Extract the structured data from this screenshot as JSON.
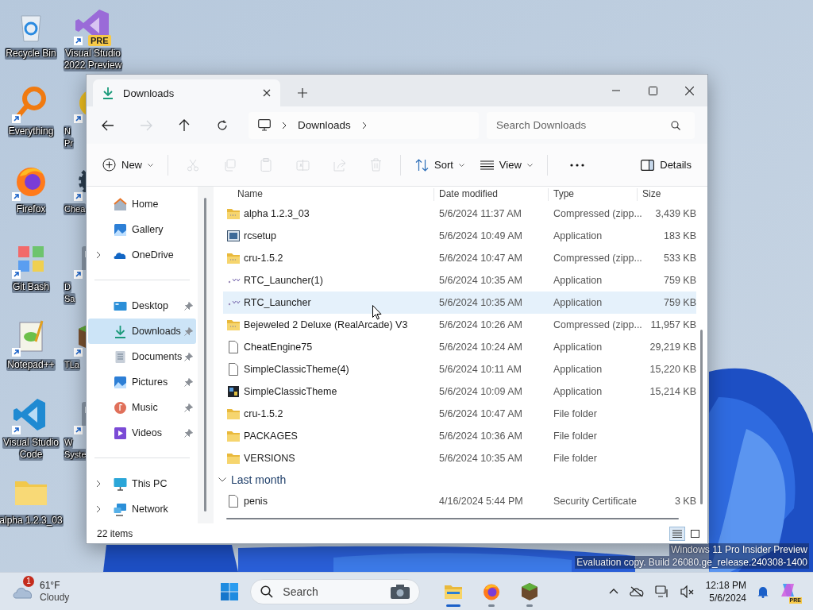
{
  "desktop": {
    "columns": [
      [
        {
          "lines": [
            "Recycle Bin"
          ],
          "kind": "recycle",
          "shortcut": false
        },
        {
          "lines": [
            "Everything"
          ],
          "kind": "magnifier",
          "shortcut": true
        },
        {
          "lines": [
            "Firefox"
          ],
          "kind": "firefox",
          "shortcut": true
        },
        {
          "lines": [
            "Git Bash"
          ],
          "kind": "git",
          "shortcut": true
        },
        {
          "lines": [
            "Notepad++"
          ],
          "kind": "notepad",
          "shortcut": true
        },
        {
          "lines": [
            "Visual Studio",
            "Code"
          ],
          "kind": "vscode",
          "shortcut": true
        },
        {
          "lines": [
            "alpha 1.2.3_03"
          ],
          "kind": "folder",
          "shortcut": false
        }
      ],
      [
        {
          "lines": [
            "Visual Studio",
            "2022 Preview"
          ],
          "kind": "vs",
          "badge": "PRE",
          "shortcut": true
        },
        {
          "lines": [
            "N",
            "Pr"
          ],
          "kind": "flame",
          "shortcut": true
        },
        {
          "lines": [
            "Chea"
          ],
          "kind": "gear",
          "shortcut": true
        },
        {
          "lines": [
            "D",
            "Sa"
          ],
          "kind": "generic",
          "shortcut": true
        },
        {
          "lines": [
            "TLa"
          ],
          "kind": "cube",
          "shortcut": true
        },
        {
          "lines": [
            "W",
            "Syste"
          ],
          "kind": "generic",
          "shortcut": true
        }
      ]
    ]
  },
  "window": {
    "tabs": [
      {
        "label": "Downloads",
        "selected": true
      }
    ],
    "nav": [
      {
        "kind": "back",
        "disabled": false
      },
      {
        "kind": "forward",
        "disabled": true
      },
      {
        "kind": "up",
        "disabled": false
      },
      {
        "kind": "refresh",
        "disabled": false
      }
    ],
    "breadcrumb": [
      "Downloads"
    ],
    "search": {
      "placeholder": "Search Downloads"
    },
    "toolbar": [
      {
        "kind": "new",
        "label": "New",
        "disabled": false
      },
      {
        "kind": "cut",
        "disabled": true
      },
      {
        "kind": "copy",
        "disabled": true
      },
      {
        "kind": "paste",
        "disabled": true
      },
      {
        "kind": "rename",
        "disabled": true
      },
      {
        "kind": "share",
        "disabled": true
      },
      {
        "kind": "delete",
        "disabled": true
      },
      {
        "kind": "sort",
        "label": "Sort",
        "disabled": false
      },
      {
        "kind": "view",
        "label": "View",
        "disabled": false
      },
      {
        "kind": "more",
        "disabled": false
      }
    ],
    "details_button": "Details",
    "sidebar": {
      "groups": [
        [
          {
            "label": "Home",
            "kind": "home",
            "expandable": false,
            "pinned": false,
            "selected": false
          },
          {
            "label": "Gallery",
            "kind": "gallery",
            "expandable": false,
            "pinned": false,
            "selected": false
          },
          {
            "label": "OneDrive",
            "kind": "cloud",
            "expandable": true,
            "pinned": false,
            "selected": false
          }
        ],
        [
          {
            "label": "Desktop",
            "kind": "desktop",
            "expandable": false,
            "pinned": true,
            "selected": false
          },
          {
            "label": "Downloads",
            "kind": "download",
            "expandable": false,
            "pinned": true,
            "selected": true
          },
          {
            "label": "Documents",
            "kind": "documents",
            "expandable": false,
            "pinned": true,
            "selected": false
          },
          {
            "label": "Pictures",
            "kind": "gallery",
            "expandable": false,
            "pinned": true,
            "selected": false
          },
          {
            "label": "Music",
            "kind": "music",
            "expandable": false,
            "pinned": true,
            "selected": false
          },
          {
            "label": "Videos",
            "kind": "videos",
            "expandable": false,
            "pinned": true,
            "selected": false
          }
        ],
        [
          {
            "label": "This PC",
            "kind": "pc",
            "expandable": true,
            "pinned": false,
            "selected": false
          },
          {
            "label": "Network",
            "kind": "network",
            "expandable": true,
            "pinned": false,
            "selected": false
          }
        ]
      ]
    },
    "columns": [
      "Name",
      "Date modified",
      "Type",
      "Size"
    ],
    "groups": [
      {
        "rows": [
          {
            "name": "alpha 1.2.3_03",
            "date": "5/6/2024 11:37 AM",
            "type": "Compressed (zipp...",
            "size": "3,439 KB",
            "kind": "zip",
            "hovered": false
          },
          {
            "name": "rcsetup",
            "date": "5/6/2024 10:49 AM",
            "type": "Application",
            "size": "183 KB",
            "kind": "setup",
            "hovered": false
          },
          {
            "name": "cru-1.5.2",
            "date": "5/6/2024 10:47 AM",
            "type": "Compressed (zipp...",
            "size": "533 KB",
            "kind": "zip",
            "hovered": false
          },
          {
            "name": "RTC_Launcher(1)",
            "date": "5/6/2024 10:35 AM",
            "type": "Application",
            "size": "759 KB",
            "kind": "launcher",
            "hovered": false
          },
          {
            "name": "RTC_Launcher",
            "date": "5/6/2024 10:35 AM",
            "type": "Application",
            "size": "759 KB",
            "kind": "launcher",
            "hovered": true
          },
          {
            "name": "Bejeweled 2 Deluxe (RealArcade) V3",
            "date": "5/6/2024 10:26 AM",
            "type": "Compressed (zipp...",
            "size": "11,957 KB",
            "kind": "zip",
            "hovered": false
          },
          {
            "name": "CheatEngine75",
            "date": "5/6/2024 10:24 AM",
            "type": "Application",
            "size": "29,219 KB",
            "kind": "blank",
            "hovered": false
          },
          {
            "name": "SimpleClassicTheme(4)",
            "date": "5/6/2024 10:11 AM",
            "type": "Application",
            "size": "15,220 KB",
            "kind": "blank",
            "hovered": false
          },
          {
            "name": "SimpleClassicTheme",
            "date": "5/6/2024 10:09 AM",
            "type": "Application",
            "size": "15,214 KB",
            "kind": "theme",
            "hovered": false
          },
          {
            "name": "cru-1.5.2",
            "date": "5/6/2024 10:47 AM",
            "type": "File folder",
            "kind": "folder",
            "hovered": false
          },
          {
            "name": "PACKAGES",
            "date": "5/6/2024 10:36 AM",
            "type": "File folder",
            "kind": "folder",
            "hovered": false
          },
          {
            "name": "VERSIONS",
            "date": "5/6/2024 10:35 AM",
            "type": "File folder",
            "kind": "folder",
            "hovered": false
          }
        ]
      },
      {
        "title": "Last month",
        "expanded": true,
        "rows": [
          {
            "name": "penis",
            "date": "4/16/2024 5:44 PM",
            "type": "Security Certificate",
            "size": "3 KB",
            "kind": "blank",
            "hovered": false
          }
        ]
      }
    ],
    "status": "22 items",
    "views": [
      {
        "kind": "details",
        "selected": true
      },
      {
        "kind": "tiles",
        "selected": false
      }
    ]
  },
  "watermark": [
    "Windows 11 Pro Insider Preview",
    "Evaluation copy. Build 26080.ge_release.240308-1400"
  ],
  "taskbar": {
    "weather": {
      "badge": "1",
      "temp": "61°F",
      "condition": "Cloudy"
    },
    "search": {
      "placeholder": "Search"
    },
    "apps": [
      {
        "kind": "explorer",
        "active": true
      },
      {
        "kind": "firefox",
        "active": false
      },
      {
        "kind": "cube",
        "active": false
      }
    ],
    "time": "12:18 PM",
    "date": "5/6/2024",
    "copilot_badge": "PRE"
  }
}
